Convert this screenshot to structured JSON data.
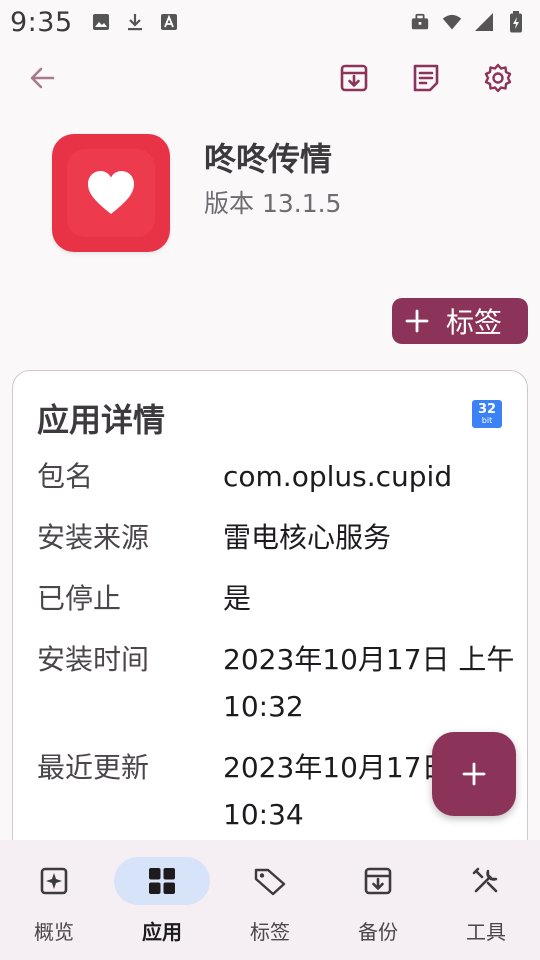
{
  "status_bar": {
    "time": "9:35",
    "icons_left": [
      "image-icon",
      "download-icon",
      "font-icon"
    ],
    "icons_right": [
      "briefcase-icon",
      "wifi-icon",
      "signal-icon",
      "battery-icon"
    ]
  },
  "app_bar": {
    "back_icon": "arrow-left-icon",
    "actions": [
      "archive-icon",
      "notes-icon",
      "settings-gear-icon"
    ]
  },
  "app": {
    "name": "咚咚传情",
    "version": "版本 13.1.5"
  },
  "tag_button": {
    "label": "标签"
  },
  "details": {
    "title": "应用详情",
    "bit_badge": {
      "number": "32",
      "unit": "bit"
    },
    "rows": [
      {
        "label": "包名",
        "value": "com.oplus.cupid"
      },
      {
        "label": "安装来源",
        "value": "雷电核心服务"
      },
      {
        "label": "已停止",
        "value": "是"
      },
      {
        "label": "安装时间",
        "value": "2023年10月17日 上午10:32"
      },
      {
        "label": "最近更新",
        "value": "2023年10月17日 上午10:34"
      }
    ]
  },
  "fab": {
    "icon": "plus-icon"
  },
  "bottom_nav": {
    "items": [
      {
        "label": "概览",
        "icon": "overview-icon",
        "active": false
      },
      {
        "label": "应用",
        "icon": "apps-grid-icon",
        "active": true
      },
      {
        "label": "标签",
        "icon": "tag-icon",
        "active": false
      },
      {
        "label": "备份",
        "icon": "backup-icon",
        "active": false
      },
      {
        "label": "工具",
        "icon": "tools-icon",
        "active": false
      }
    ]
  },
  "colors": {
    "accent": "#8b3358",
    "app_icon": "#e83346",
    "nav_active_pill": "#d7e3f8",
    "badge_blue": "#3b82f6"
  }
}
